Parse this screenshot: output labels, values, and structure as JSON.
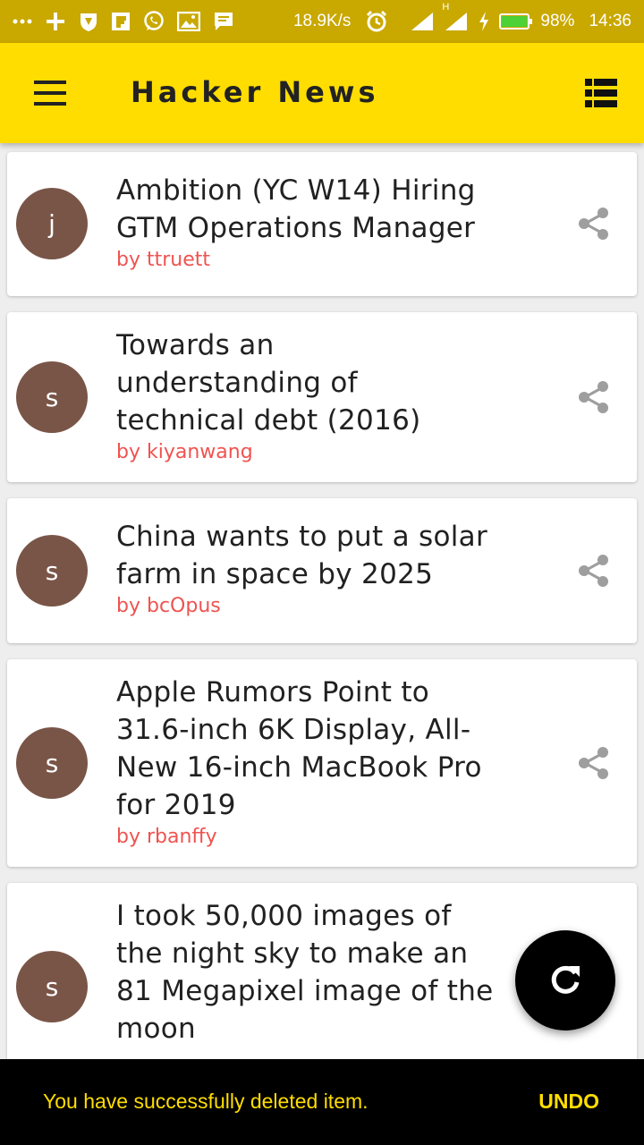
{
  "status_bar": {
    "net_speed": "18.9K/s",
    "net_type": "H",
    "battery": "98%",
    "battery_level": 0.98,
    "time": "14:36",
    "left_icons": [
      "more-icon",
      "plus-icon",
      "shield-icon",
      "flipboard-icon",
      "whatsapp-icon",
      "image-icon",
      "message-icon"
    ],
    "right_icons": [
      "alarm-icon",
      "signal-icon",
      "signal-icon",
      "charging-icon",
      "battery-icon"
    ]
  },
  "appbar": {
    "title": "Hacker News",
    "bg_color": "#ffdd00",
    "menu_icon": "menu-icon",
    "action_icon": "view-list-icon"
  },
  "stories": [
    {
      "avatar_letter": "j",
      "title_lines": [
        "Ambition (YC W14) Hiring",
        "GTM Operations Manager"
      ],
      "author": "by ttruett"
    },
    {
      "avatar_letter": "s",
      "title_lines": [
        "Towards an",
        "understanding of",
        "technical debt (2016)"
      ],
      "author": "by kiyanwang"
    },
    {
      "avatar_letter": "s",
      "title_lines": [
        "China wants to put a solar",
        "farm in space by 2025"
      ],
      "author": "by bcOpus"
    },
    {
      "avatar_letter": "s",
      "title_lines": [
        "Apple Rumors Point to",
        "31.6-inch 6K Display, All-",
        "New 16-inch MacBook Pro",
        "for 2019"
      ],
      "author": "by rbanffy"
    },
    {
      "avatar_letter": "s",
      "title_lines": [
        "I took 50,000 images of",
        "the night sky to make an",
        "81 Megapixel image of the",
        "moon"
      ],
      "author": ""
    }
  ],
  "colors": {
    "avatar": "#795548",
    "author": "#ef5350",
    "accent": "#ffdd00",
    "status_bar": "#c9a800"
  },
  "fab": {
    "icon": "refresh-icon"
  },
  "snackbar": {
    "message": "You have successfully deleted item.",
    "action": "UNDO"
  }
}
